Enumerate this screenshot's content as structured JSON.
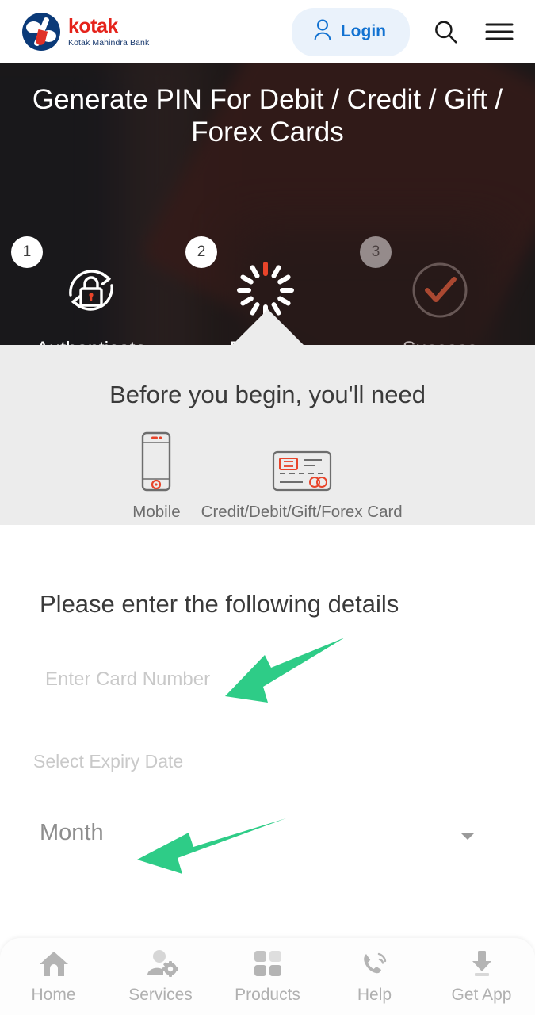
{
  "header": {
    "brand_word": "kotak",
    "brand_sub": "Kotak Mahindra Bank",
    "login_label": "Login",
    "login_bg": "#eaf2fb",
    "login_color": "#1272d1",
    "icons": {
      "user": "user-icon",
      "search": "search-icon",
      "menu": "hamburger-menu-icon"
    }
  },
  "hero": {
    "title": "Generate PIN For Debit / Credit / Gift / Forex Cards",
    "steps": [
      {
        "number": "1",
        "label": "Authenticate",
        "icon": "lock-refresh-icon",
        "state": "active"
      },
      {
        "number": "2",
        "label": "Process",
        "icon": "spinner-icon",
        "state": "active"
      },
      {
        "number": "3",
        "label": "Success",
        "icon": "check-circle-icon",
        "state": "inactive"
      }
    ]
  },
  "before": {
    "title": "Before you begin, you'll need",
    "items": [
      {
        "label": "Mobile",
        "icon": "mobile-phone-icon"
      },
      {
        "label": "Credit/Debit/Gift/Forex Card",
        "icon": "credit-card-icon"
      }
    ]
  },
  "form": {
    "title": "Please enter the following details",
    "card_number": {
      "placeholder": "Enter Card Number",
      "value": "",
      "segments": 4
    },
    "expiry_label": "Select Expiry Date",
    "month": {
      "placeholder": "Month",
      "value": "",
      "caret": "chevron-down-icon"
    }
  },
  "annotations": {
    "color": "#2ecc87",
    "arrows": [
      {
        "name": "arrow-to-card-number",
        "target": "Enter Card Number"
      },
      {
        "name": "arrow-to-month-dropdown",
        "target": "Month"
      }
    ]
  },
  "bottom_nav": {
    "items": [
      {
        "label": "Home",
        "icon": "home-icon"
      },
      {
        "label": "Services",
        "icon": "person-gear-icon"
      },
      {
        "label": "Products",
        "icon": "grid-squares-icon"
      },
      {
        "label": "Help",
        "icon": "phone-call-icon"
      },
      {
        "label": "Get App",
        "icon": "download-icon"
      }
    ]
  }
}
